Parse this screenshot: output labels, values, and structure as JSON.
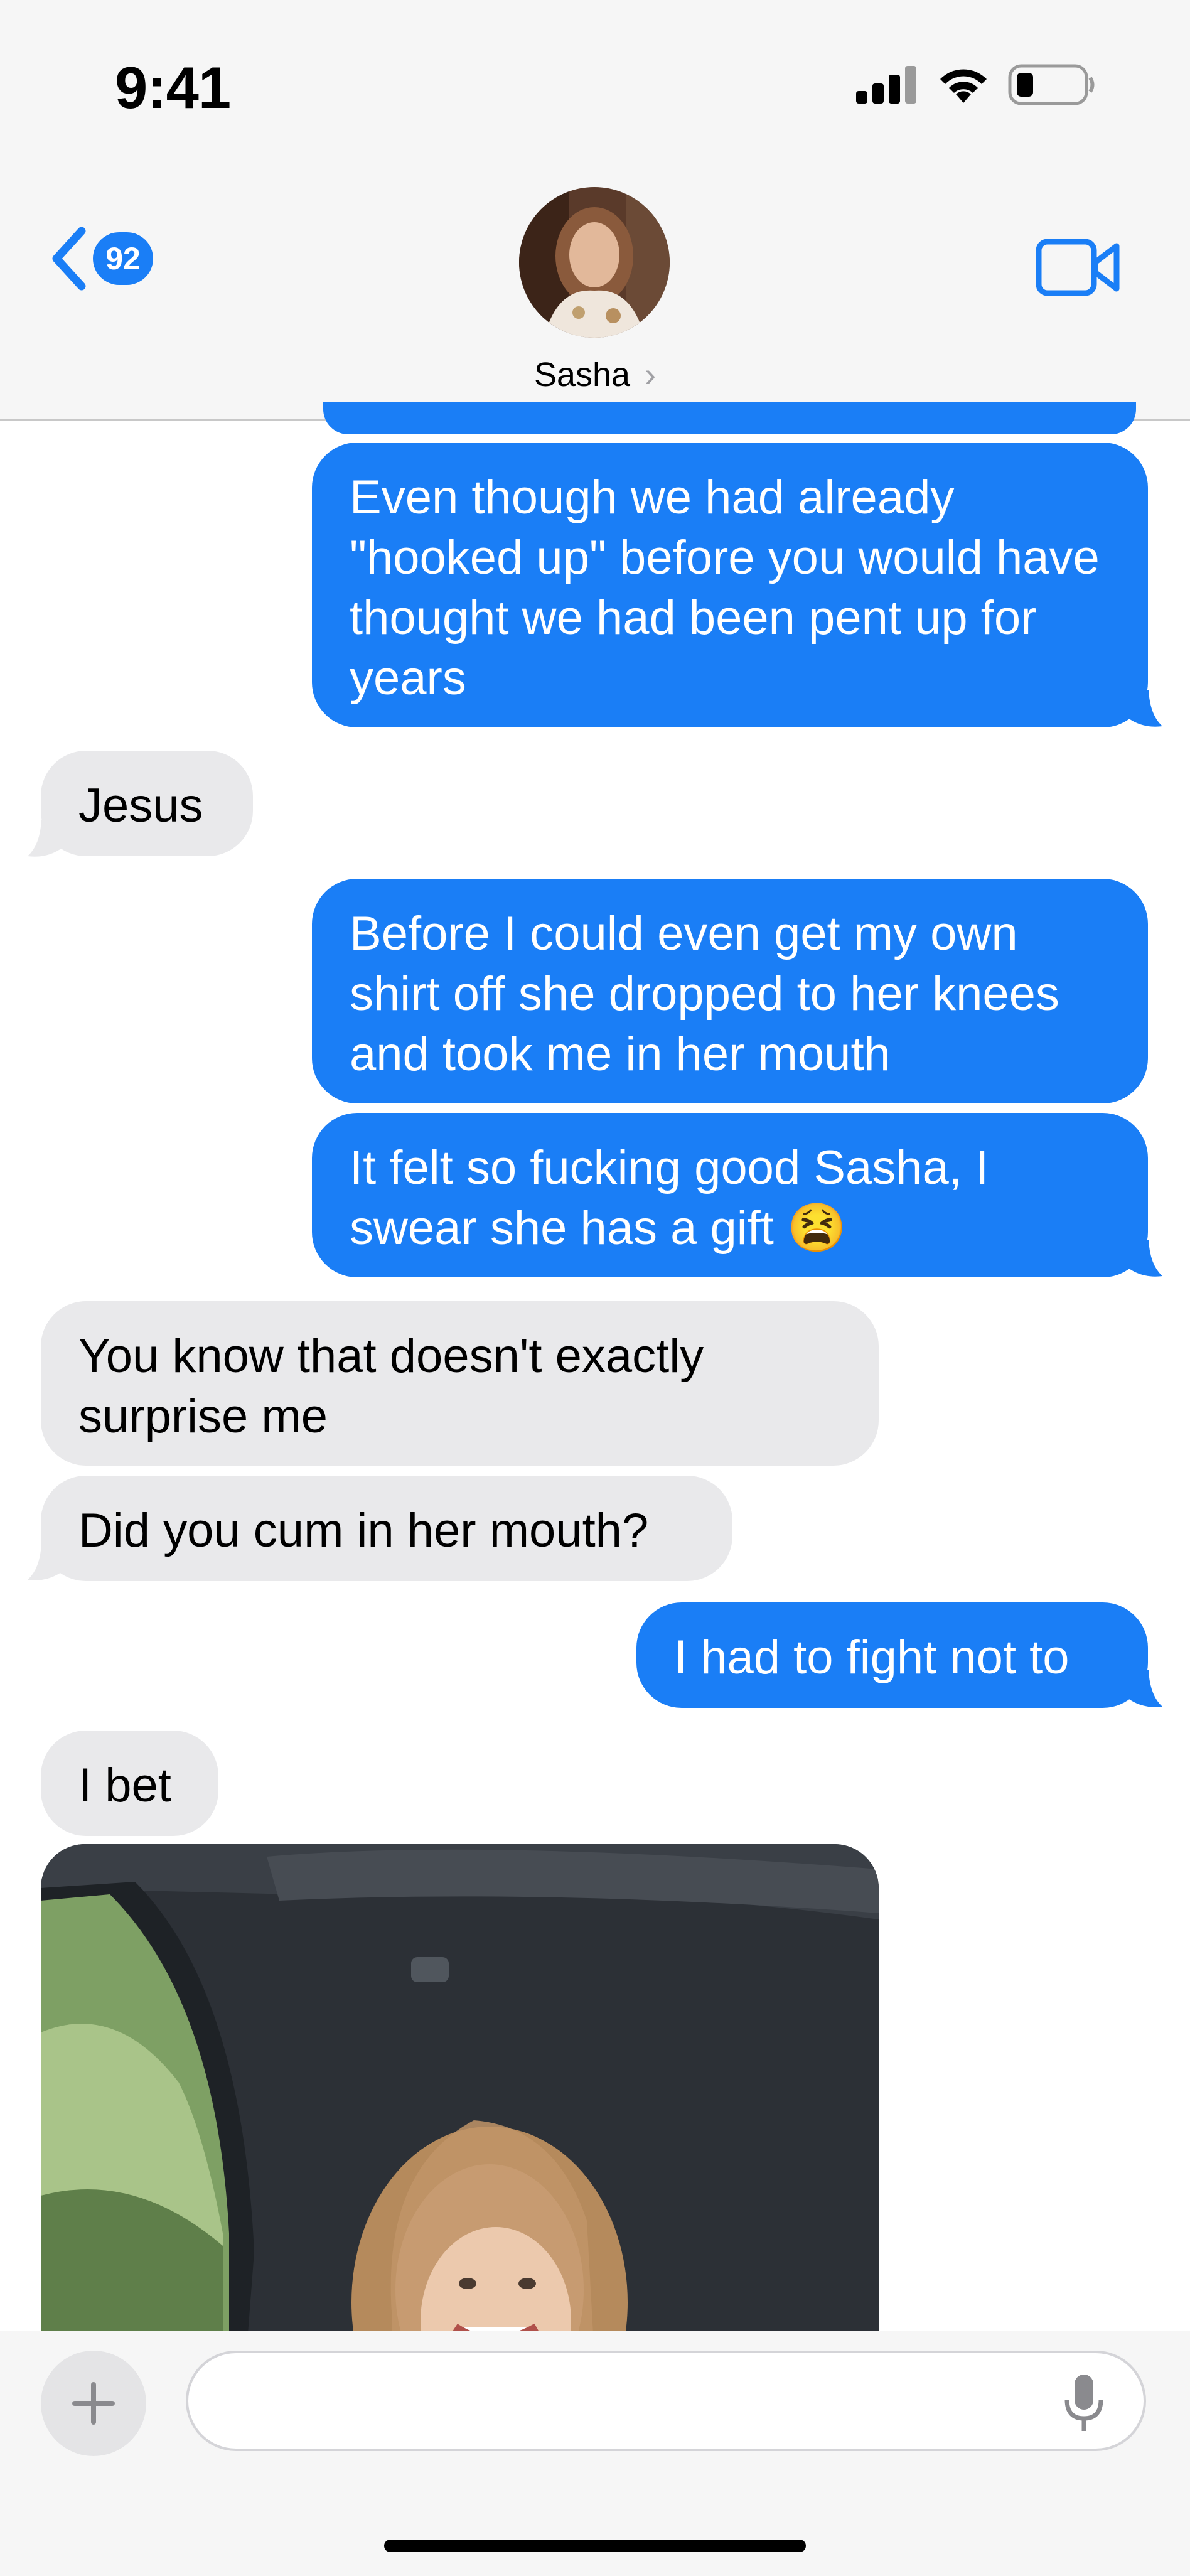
{
  "status_bar": {
    "time": "9:41"
  },
  "header": {
    "back_count": "92",
    "contact_name": "Sasha",
    "contact_chevron": "›"
  },
  "messages": [
    {
      "dir": "out",
      "text": "Even though we had already \"hooked up\" before you would have thought we had been pent up for years"
    },
    {
      "dir": "in",
      "text": "Jesus"
    },
    {
      "dir": "out",
      "text": "Before I could even get my own shirt off she dropped to her knees and took me in her mouth"
    },
    {
      "dir": "out",
      "text": "It felt so fucking good Sasha, I swear she has a gift",
      "emoji": "😫"
    },
    {
      "dir": "in",
      "text": "You know that doesn't exactly surprise me"
    },
    {
      "dir": "in",
      "text": "Did you cum in her mouth?"
    },
    {
      "dir": "out",
      "text": "I had to fight not to"
    },
    {
      "dir": "in",
      "text": "I bet"
    }
  ],
  "composer": {
    "placeholder": ""
  },
  "colors": {
    "outgoing": "#1a7ef6",
    "incoming": "#e9e9eb",
    "accent": "#1a7ef6"
  },
  "icons": [
    "signal-icon",
    "wifi-icon",
    "battery-icon",
    "back-chevron-icon",
    "video-call-icon",
    "plus-icon",
    "microphone-icon"
  ]
}
